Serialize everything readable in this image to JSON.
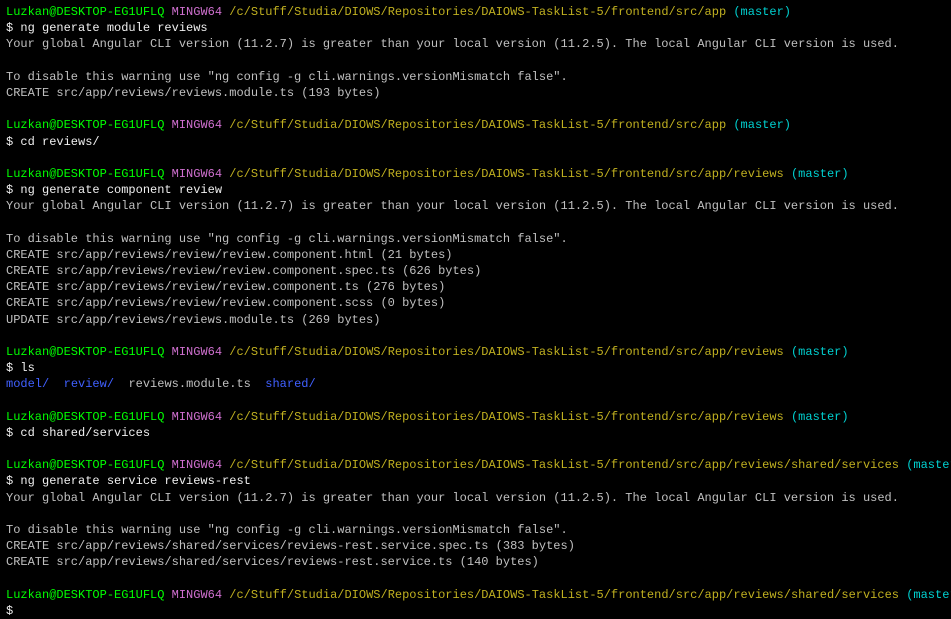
{
  "user": "Luzkan@DESKTOP-EG1UFLQ",
  "shell": "MINGW64",
  "prompt_symbol": "$",
  "paths": {
    "app": "/c/Stuff/Studia/DIOWS/Repositories/DAIOWS-TaskList-5/frontend/src/app",
    "reviews": "/c/Stuff/Studia/DIOWS/Repositories/DAIOWS-TaskList-5/frontend/src/app/reviews",
    "services": "/c/Stuff/Studia/DIOWS/Repositories/DAIOWS-TaskList-5/frontend/src/app/reviews/shared/services"
  },
  "branch": "(master)",
  "commands": {
    "gen_module": "ng generate module reviews",
    "cd_reviews": "cd reviews/",
    "gen_component": "ng generate component review",
    "ls": "ls",
    "cd_services": "cd shared/services",
    "gen_service": "ng generate service reviews-rest"
  },
  "output": {
    "version_warning": "Your global Angular CLI version (11.2.7) is greater than your local version (11.2.5). The local Angular CLI version is used.",
    "disable_warning": "To disable this warning use \"ng config -g cli.warnings.versionMismatch false\".",
    "create_module": "CREATE src/app/reviews/reviews.module.ts (193 bytes)",
    "create_comp_html": "CREATE src/app/reviews/review/review.component.html (21 bytes)",
    "create_comp_spec": "CREATE src/app/reviews/review/review.component.spec.ts (626 bytes)",
    "create_comp_ts": "CREATE src/app/reviews/review/review.component.ts (276 bytes)",
    "create_comp_scss": "CREATE src/app/reviews/review/review.component.scss (0 bytes)",
    "update_module": "UPDATE src/app/reviews/reviews.module.ts (269 bytes)",
    "create_svc_spec": "CREATE src/app/reviews/shared/services/reviews-rest.service.spec.ts (383 bytes)",
    "create_svc_ts": "CREATE src/app/reviews/shared/services/reviews-rest.service.ts (140 bytes)"
  },
  "ls_output": {
    "model": "model/",
    "review": "review/",
    "module_file": "reviews.module.ts",
    "shared": "shared/"
  }
}
